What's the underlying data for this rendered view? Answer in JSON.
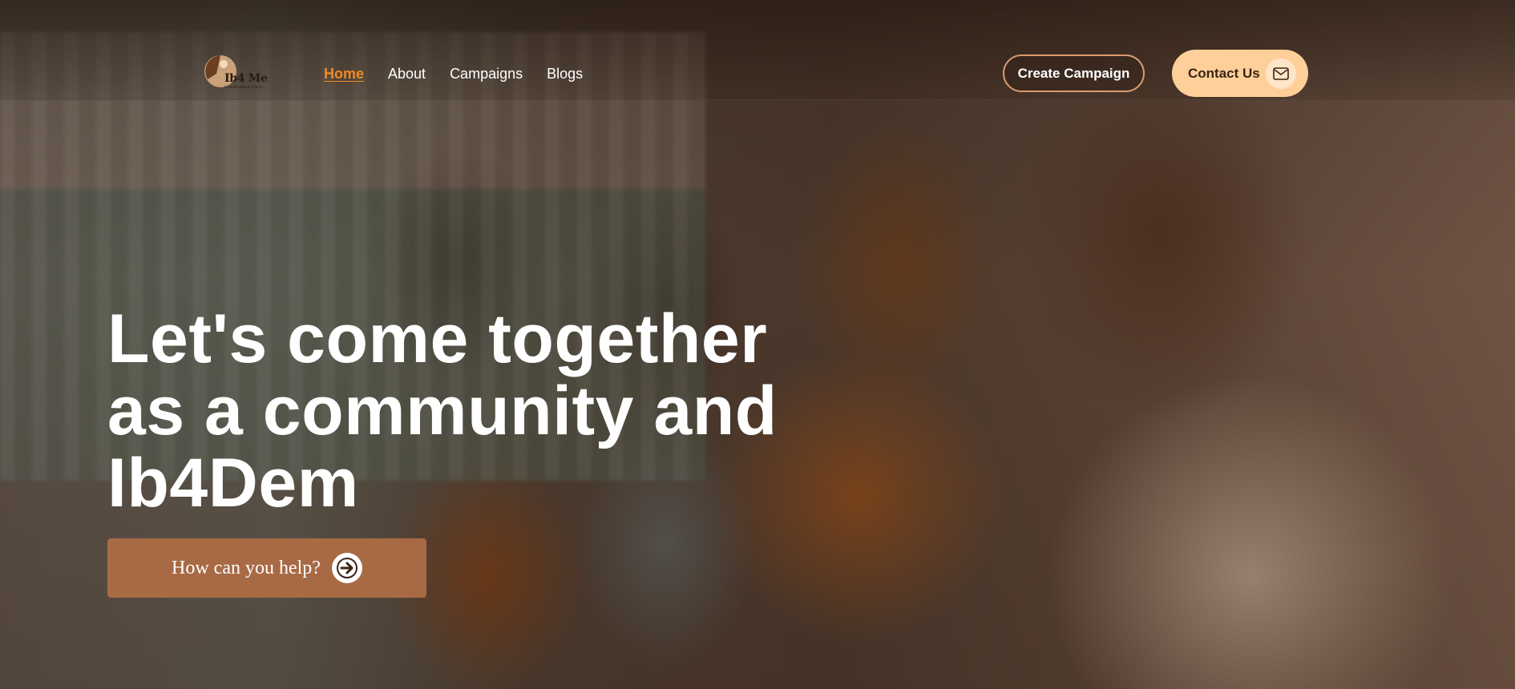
{
  "nav": {
    "logo": {
      "name": "Ib4 Me",
      "tagline": "Crowdfunding & Charity"
    },
    "links": [
      {
        "label": "Home",
        "active": true
      },
      {
        "label": "About",
        "active": false
      },
      {
        "label": "Campaigns",
        "active": false
      },
      {
        "label": "Blogs",
        "active": false
      }
    ],
    "create_campaign_label": "Create Campaign",
    "contact_label": "Contact Us",
    "contact_icon": "mail-icon"
  },
  "hero": {
    "headline_lines": [
      "Let's come together",
      "as a community and",
      "Ib4Dem"
    ],
    "cta_label": "How can you help?",
    "cta_icon": "arrow-right-icon"
  },
  "colors": {
    "accent_orange": "#f08a24",
    "cta_brown": "#a86a45",
    "contact_peach": "#ffcf9a",
    "outline_tan": "#d89a72"
  }
}
